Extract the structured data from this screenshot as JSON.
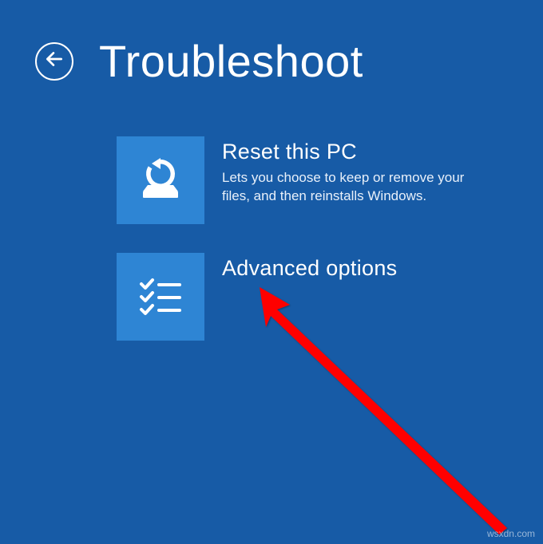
{
  "header": {
    "title": "Troubleshoot"
  },
  "options": [
    {
      "id": "reset-pc",
      "title": "Reset this PC",
      "description": "Lets you choose to keep or remove your files, and then reinstalls Windows."
    },
    {
      "id": "advanced-options",
      "title": "Advanced options",
      "description": ""
    }
  ],
  "watermark": "wsxdn.com"
}
